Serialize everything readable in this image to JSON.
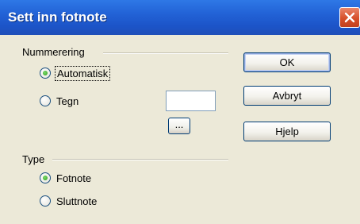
{
  "window": {
    "title": "Sett inn fotnote"
  },
  "numbering": {
    "label": "Nummerering",
    "options": [
      {
        "label": "Automatisk",
        "checked": true,
        "focused": true
      },
      {
        "label": "Tegn",
        "checked": false
      }
    ],
    "char_value": "",
    "browse_label": "..."
  },
  "type": {
    "label": "Type",
    "options": [
      {
        "label": "Fotnote",
        "checked": true
      },
      {
        "label": "Sluttnote",
        "checked": false
      }
    ]
  },
  "buttons": {
    "ok": "OK",
    "cancel": "Avbryt",
    "help": "Hjelp"
  }
}
